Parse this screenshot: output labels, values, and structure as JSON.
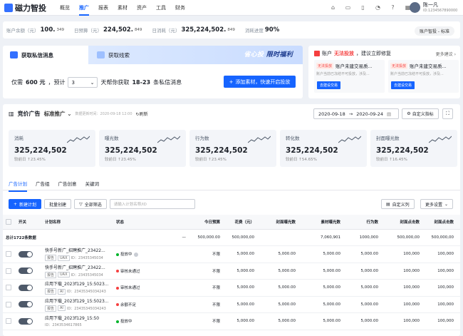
{
  "app": {
    "logo": "磁力智投"
  },
  "nav": [
    "概览",
    "推广",
    "报表",
    "素材",
    "资产",
    "工具",
    "财务"
  ],
  "user": {
    "name": "陈一凡",
    "id": "ID:1234567890000"
  },
  "stats": [
    {
      "label": "账户余额（元）",
      "value": "100.",
      "sub": "349"
    },
    {
      "label": "日预算（元）",
      "value": "224,502.",
      "sub": "849"
    },
    {
      "label": "日消耗（元）",
      "value": "325,224,502.",
      "sub": "849"
    },
    {
      "label": "消耗进度",
      "value": "90%",
      "sub": ""
    }
  ],
  "account_pill": "账户智投 - 标准",
  "promo": {
    "tab_a": "获取私信消息",
    "tab_b": "获取线索",
    "banner_a": "省心投",
    "banner_b": "限时福利",
    "prefix": "仅需",
    "price": "600 元",
    "mid": "，预计",
    "qty": "3",
    "suffix": "天帮你获取",
    "range": "18-23",
    "tail": "条私信消息",
    "button": "添加素材，快速开启投放"
  },
  "alert": {
    "title_prefix": "账户",
    "title_red": "无法投放",
    "title_suffix": "，建议立即修复",
    "more": "更多建议",
    "items": [
      {
        "tag": "无法投放",
        "title": "账户未建交易质...",
        "desc": "账户当前已冻结不可投放，涉及...",
        "btn": "去建设交易"
      },
      {
        "tag": "无法投放",
        "title": "账户未建交易质...",
        "desc": "账户当前已冻结不可投放，涉及...",
        "btn": "去建设交易"
      }
    ]
  },
  "main": {
    "title": "竞价广告",
    "scope": "标准推广",
    "updated": "数据更新时间：2020-09-18 12:00",
    "refresh": "刷新",
    "date_from": "2020-09-18",
    "date_to": "2020-09-24",
    "custom": "自定义指标",
    "metrics": [
      {
        "label": "消耗",
        "value": "325,224,502",
        "delta": "较前日 ↑23.45%"
      },
      {
        "label": "曝光数",
        "value": "325,224,502",
        "delta": "较前日 ↑23.45%"
      },
      {
        "label": "行为数",
        "value": "325,224,502",
        "delta": "较前日 ↑23.45%"
      },
      {
        "label": "转化数",
        "value": "325,224,502",
        "delta": "较前日 ↑54.65%"
      },
      {
        "label": "封面曝光数",
        "value": "325,224,502",
        "delta": "较前日 ↑16.45%"
      }
    ],
    "tabs": [
      "广告计划",
      "广告组",
      "广告创意",
      "关键词"
    ],
    "toolbar": {
      "new": "新建计划",
      "batch": "批量创建",
      "filter": "全部筛选",
      "search_ph": "请输入计划名称/ID",
      "customcol": "自定义列",
      "more": "更多设置"
    },
    "columns": [
      "开关",
      "计划名称",
      "状态",
      "今日预算",
      "花费（元）",
      "封面曝光数",
      "素材曝光数",
      "行为数",
      "封面点击数",
      "封面点击数"
    ],
    "total": {
      "label": "总计1722条数据",
      "dash1": "—",
      "dash2": "—",
      "budget": "500,000.00",
      "cost": "500,000,00",
      "imp": "",
      "mimp": "7,060,901",
      "act": "1000,000",
      "c1": "500,000,00",
      "c2": "500,000,00"
    },
    "rows": [
      {
        "name": "快手号新广_招聘推广_23422...",
        "tags": [
          "报告",
          "UAX"
        ],
        "pid": "ID：23435345034",
        "status": "投放中",
        "sc": "g",
        "budget": "不限",
        "cost": "5,000.00",
        "imp": "5,000.00",
        "mimp": "5,000.00",
        "act": "5,000.00",
        "c1": "100,000",
        "c2": "100,000"
      },
      {
        "name": "快手号新广_招聘推广_23422...",
        "tags": [
          "报告",
          "UAX"
        ],
        "pid": "ID：23435345034",
        "status": "审核未通过",
        "sc": "r",
        "budget": "不限",
        "cost": "5,000.00",
        "imp": "5,000.00",
        "mimp": "5,000.00",
        "act": "5,000.00",
        "c1": "100,000",
        "c2": "100,000"
      },
      {
        "name": "应用下载_2023f129_15:5023...",
        "tags": [
          "报告",
          "AI"
        ],
        "pid": "ID：23435345034243",
        "status": "审核未通过",
        "sc": "r",
        "budget": "不限",
        "cost": "5,000.00",
        "imp": "5,000.00",
        "mimp": "5,000.00",
        "act": "5,000.00",
        "c1": "100,000",
        "c2": "100,000"
      },
      {
        "name": "应用下载_2023f129_15:5023...",
        "tags": [
          "报告",
          "AI"
        ],
        "pid": "ID：23435345034243",
        "status": "余额不足",
        "sc": "r",
        "budget": "不限",
        "cost": "5,000.00",
        "imp": "5,000.00",
        "mimp": "5,000.00",
        "act": "5,000.00",
        "c1": "100,000",
        "c2": "100,000"
      },
      {
        "name": "应用下载_2023f129_15:50",
        "tags": [],
        "pid": "ID：2343534617865",
        "status": "投放中",
        "sc": "g",
        "budget": "不限",
        "cost": "5,000.00",
        "imp": "5,000.00",
        "mimp": "5,000.00",
        "act": "5,000.00",
        "c1": "100,000",
        "c2": "100,000"
      }
    ]
  }
}
